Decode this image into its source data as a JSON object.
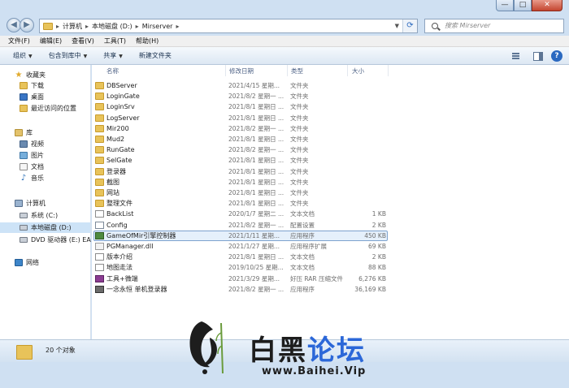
{
  "window": {
    "minimize": "—",
    "maximize": "□",
    "close": "✕"
  },
  "address": {
    "crumbs": [
      "计算机",
      "本地磁盘 (D:)",
      "Mirserver"
    ],
    "separator": "▸",
    "search_placeholder": "搜索 Mirserver"
  },
  "menubar": [
    "文件(F)",
    "编辑(E)",
    "查看(V)",
    "工具(T)",
    "帮助(H)"
  ],
  "toolbar": {
    "items": [
      "组织",
      "包含到库中",
      "共享",
      "新建文件夹"
    ],
    "dropdown_arrow": "▼"
  },
  "sidebar": {
    "favorites": {
      "label": "收藏夹",
      "items": [
        "下载",
        "桌面",
        "最近访问的位置"
      ]
    },
    "libraries": {
      "label": "库",
      "items": [
        "视频",
        "图片",
        "文档",
        "音乐"
      ]
    },
    "computer": {
      "label": "计算机",
      "items": [
        "系统 (C:)",
        "本地磁盘 (D:)",
        "DVD 驱动器 (E:) EA"
      ]
    },
    "network": {
      "label": "网络"
    }
  },
  "columns": {
    "name": "名称",
    "date": "修改日期",
    "type": "类型",
    "size": "大小"
  },
  "files": [
    {
      "name": "DBServer",
      "date": "2021/4/15 星期...",
      "type": "文件夹",
      "size": "",
      "icon": "folder"
    },
    {
      "name": "LoginGate",
      "date": "2021/8/2 星期一 ...",
      "type": "文件夹",
      "size": "",
      "icon": "folder"
    },
    {
      "name": "LoginSrv",
      "date": "2021/8/1 星期日 ...",
      "type": "文件夹",
      "size": "",
      "icon": "folder"
    },
    {
      "name": "LogServer",
      "date": "2021/8/1 星期日 ...",
      "type": "文件夹",
      "size": "",
      "icon": "folder"
    },
    {
      "name": "Mir200",
      "date": "2021/8/2 星期一 ...",
      "type": "文件夹",
      "size": "",
      "icon": "folder"
    },
    {
      "name": "Mud2",
      "date": "2021/8/1 星期日 ...",
      "type": "文件夹",
      "size": "",
      "icon": "folder"
    },
    {
      "name": "RunGate",
      "date": "2021/8/2 星期一 ...",
      "type": "文件夹",
      "size": "",
      "icon": "folder"
    },
    {
      "name": "SelGate",
      "date": "2021/8/1 星期日 ...",
      "type": "文件夹",
      "size": "",
      "icon": "folder"
    },
    {
      "name": "登录器",
      "date": "2021/8/1 星期日 ...",
      "type": "文件夹",
      "size": "",
      "icon": "folder"
    },
    {
      "name": "截图",
      "date": "2021/8/1 星期日 ...",
      "type": "文件夹",
      "size": "",
      "icon": "folder"
    },
    {
      "name": "网站",
      "date": "2021/8/1 星期日 ...",
      "type": "文件夹",
      "size": "",
      "icon": "folder"
    },
    {
      "name": "整理文件",
      "date": "2021/8/1 星期日 ...",
      "type": "文件夹",
      "size": "",
      "icon": "folder"
    },
    {
      "name": "BackList",
      "date": "2020/1/7 星期二 ...",
      "type": "文本文档",
      "size": "1 KB",
      "icon": "text"
    },
    {
      "name": "Config",
      "date": "2021/8/2 星期一 ...",
      "type": "配置设置",
      "size": "2 KB",
      "icon": "config"
    },
    {
      "name": "GameOfMir引擎控制器",
      "date": "2021/1/11 星期...",
      "type": "应用程序",
      "size": "450 KB",
      "icon": "app"
    },
    {
      "name": "PGManager.dll",
      "date": "2021/1/27 星期...",
      "type": "应用程序扩展",
      "size": "69 KB",
      "icon": "dll"
    },
    {
      "name": "版本介绍",
      "date": "2021/8/1 星期日 ...",
      "type": "文本文档",
      "size": "2 KB",
      "icon": "text"
    },
    {
      "name": "地图走法",
      "date": "2019/10/25 星期...",
      "type": "文本文档",
      "size": "88 KB",
      "icon": "text"
    },
    {
      "name": "工具+微端",
      "date": "2021/3/29 星期...",
      "type": "好压 RAR 压缩文件",
      "size": "6,276 KB",
      "icon": "rar"
    },
    {
      "name": "一念永恒 单机登录器",
      "date": "2021/8/2 星期一 ...",
      "type": "应用程序",
      "size": "36,169 KB",
      "icon": "app2"
    }
  ],
  "selected_row": 14,
  "status": {
    "count": "20 个对象"
  },
  "watermark": {
    "brand": "白黑",
    "brand_accent": "论坛",
    "url": "www.Baihei.Vip"
  }
}
